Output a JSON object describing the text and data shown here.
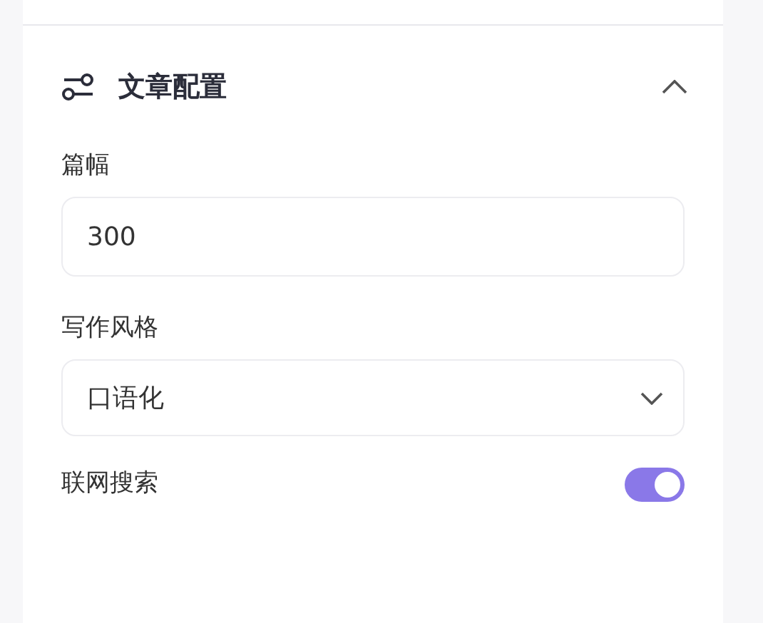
{
  "section": {
    "title": "文章配置",
    "expanded": true,
    "fields": [
      {
        "kind": "input",
        "label": "篇幅",
        "value": "300"
      },
      {
        "kind": "select",
        "label": "写作风格",
        "value": "口语化"
      },
      {
        "kind": "switch",
        "label": "联网搜索",
        "on": true
      }
    ]
  }
}
